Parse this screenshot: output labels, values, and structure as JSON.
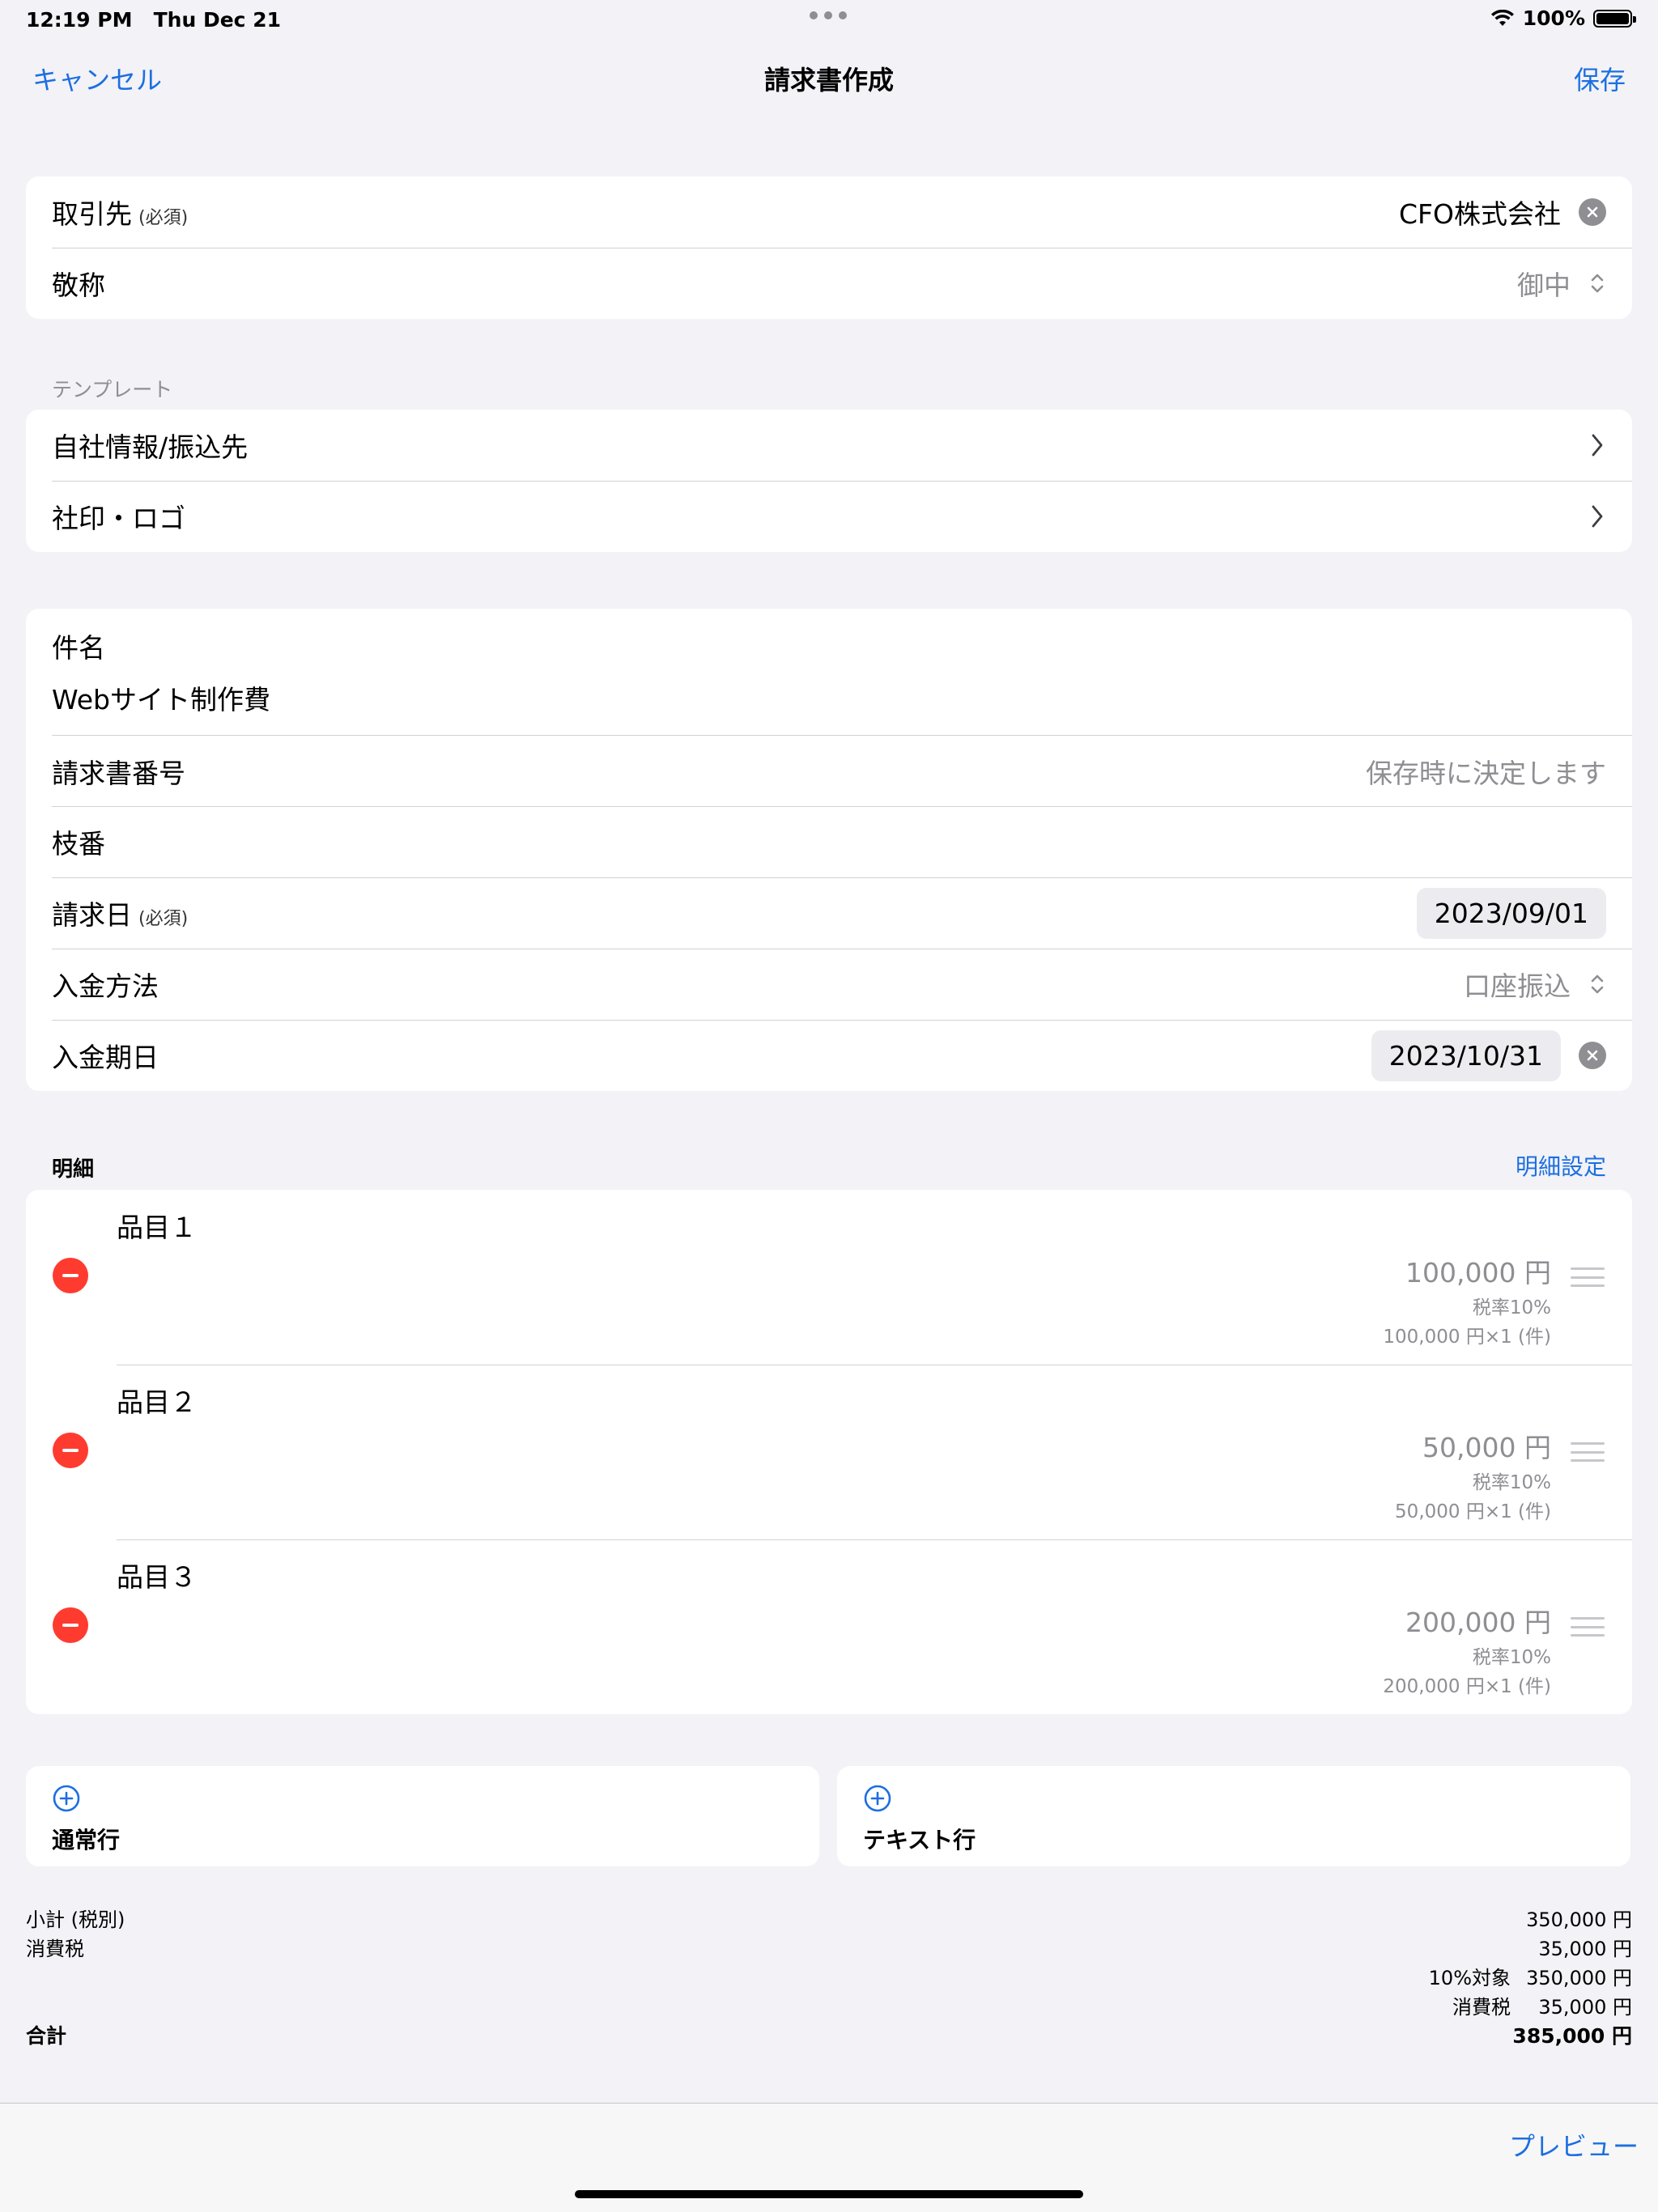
{
  "status": {
    "time": "12:19 PM",
    "date": "Thu Dec 21",
    "battery": "100%",
    "battery_level": 1.0
  },
  "nav": {
    "cancel": "キャンセル",
    "title": "請求書作成",
    "save": "保存"
  },
  "client": {
    "label": "取引先",
    "required": "(必須)",
    "value": "CFO株式会社",
    "honorific_label": "敬称",
    "honorific_value": "御中"
  },
  "template": {
    "section": "テンプレート",
    "company_info": "自社情報/振込先",
    "seal_logo": "社印・ロゴ"
  },
  "details": {
    "subject_label": "件名",
    "subject_value": "Webサイト制作費",
    "invoice_no_label": "請求書番号",
    "invoice_no_value": "保存時に決定します",
    "branch_label": "枝番",
    "date_label": "請求日",
    "date_required": "(必須)",
    "date_value": "2023/09/01",
    "payment_method_label": "入金方法",
    "payment_method_value": "口座振込",
    "due_label": "入金期日",
    "due_value": "2023/10/31"
  },
  "lines": {
    "header": "明細",
    "settings": "明細設定",
    "items": [
      {
        "name": "品目１",
        "price": "100,000 円",
        "tax": "税率10%",
        "qty": "100,000 円×1 (件)"
      },
      {
        "name": "品目２",
        "price": "50,000 円",
        "tax": "税率10%",
        "qty": "50,000 円×1 (件)"
      },
      {
        "name": "品目３",
        "price": "200,000 円",
        "tax": "税率10%",
        "qty": "200,000 円×1 (件)"
      }
    ]
  },
  "add": {
    "normal": "通常行",
    "text": "テキスト行"
  },
  "totals": {
    "subtotal_label": "小計 (税別)",
    "subtotal_value": "350,000 円",
    "tax_label": "消費税",
    "tax_value": "35,000 円",
    "tax10_label": "10%対象",
    "tax10_value": "350,000 円",
    "tax10_tax_label": "消費税",
    "tax10_tax_value": "35,000 円",
    "total_label": "合計",
    "total_value": "385,000 円"
  },
  "toolbar": {
    "preview": "プレビュー"
  },
  "colors": {
    "accent": "#1c6fe0",
    "delete": "#ff3b30",
    "background": "#f2f2f7"
  }
}
